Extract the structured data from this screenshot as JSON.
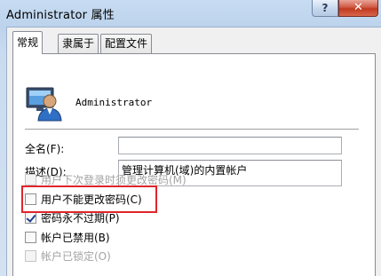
{
  "window": {
    "title": "Administrator 属性",
    "help_label": "?",
    "close_label": "✕"
  },
  "tabs": [
    {
      "label": "常规",
      "active": true
    },
    {
      "label": "隶属于",
      "active": false
    },
    {
      "label": "配置文件",
      "active": false
    }
  ],
  "user": {
    "avatar_icon": "user-avatar-icon",
    "name": "Administrator"
  },
  "fields": {
    "fullname_label": "全名(F):",
    "fullname_value": "",
    "description_label": "描述(D):",
    "description_value": "管理计算机(域)的内置帐户"
  },
  "options": [
    {
      "label": "用户下次登录时须更改密码(M)",
      "checked": false,
      "disabled": true
    },
    {
      "label": "用户不能更改密码(C)",
      "checked": false,
      "disabled": false
    },
    {
      "label": "密码永不过期(P)",
      "checked": true,
      "disabled": false
    },
    {
      "label": "帐户已禁用(B)",
      "checked": false,
      "disabled": false
    },
    {
      "label": "帐户已锁定(O)",
      "checked": false,
      "disabled": true
    }
  ],
  "colors": {
    "highlight": "#e0242a",
    "close_button": "#c0391f"
  }
}
